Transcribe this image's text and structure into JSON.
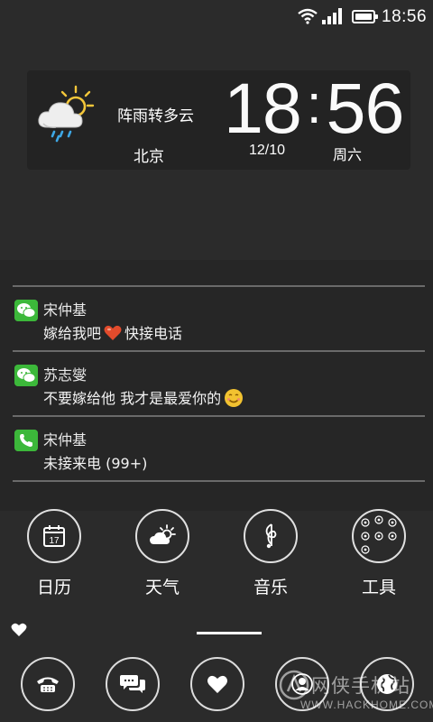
{
  "status_bar": {
    "time": "18:56"
  },
  "weather_widget": {
    "condition": "阵雨转多云",
    "city": "北京",
    "clock_hour": "18",
    "clock_minute": "56",
    "date": "12/10",
    "weekday": "周六",
    "icon": "rain-cloud-sun-icon"
  },
  "notifications": [
    {
      "app_icon": "wechat-icon",
      "sender": "宋仲基",
      "message_before": "嫁给我吧",
      "message_after": "快接电话",
      "emoji": "heart"
    },
    {
      "app_icon": "wechat-icon",
      "sender": "苏志燮",
      "message": "不要嫁给他  我才是最爱你的",
      "emoji": "smile"
    },
    {
      "app_icon": "phone-icon",
      "sender": "宋仲基",
      "message": "未接来电 (99+)"
    }
  ],
  "apps": [
    {
      "label": "日历",
      "icon": "calendar-icon",
      "calendar_day": "17"
    },
    {
      "label": "天气",
      "icon": "weather-icon"
    },
    {
      "label": "音乐",
      "icon": "music-icon"
    },
    {
      "label": "工具",
      "icon": "tools-icon"
    }
  ],
  "dock": [
    {
      "icon": "phone-icon"
    },
    {
      "icon": "messages-icon"
    },
    {
      "icon": "heart-icon"
    },
    {
      "icon": "contacts-icon"
    },
    {
      "icon": "browser-icon"
    }
  ],
  "watermark": {
    "text": "网侠手机站",
    "url": "WWW.HACKHOME.COM"
  },
  "colors": {
    "background": "#2b2b2b",
    "wechat_green": "#3cb83a",
    "heart_red": "#e24b2c",
    "smile_yellow": "#f2c230"
  }
}
